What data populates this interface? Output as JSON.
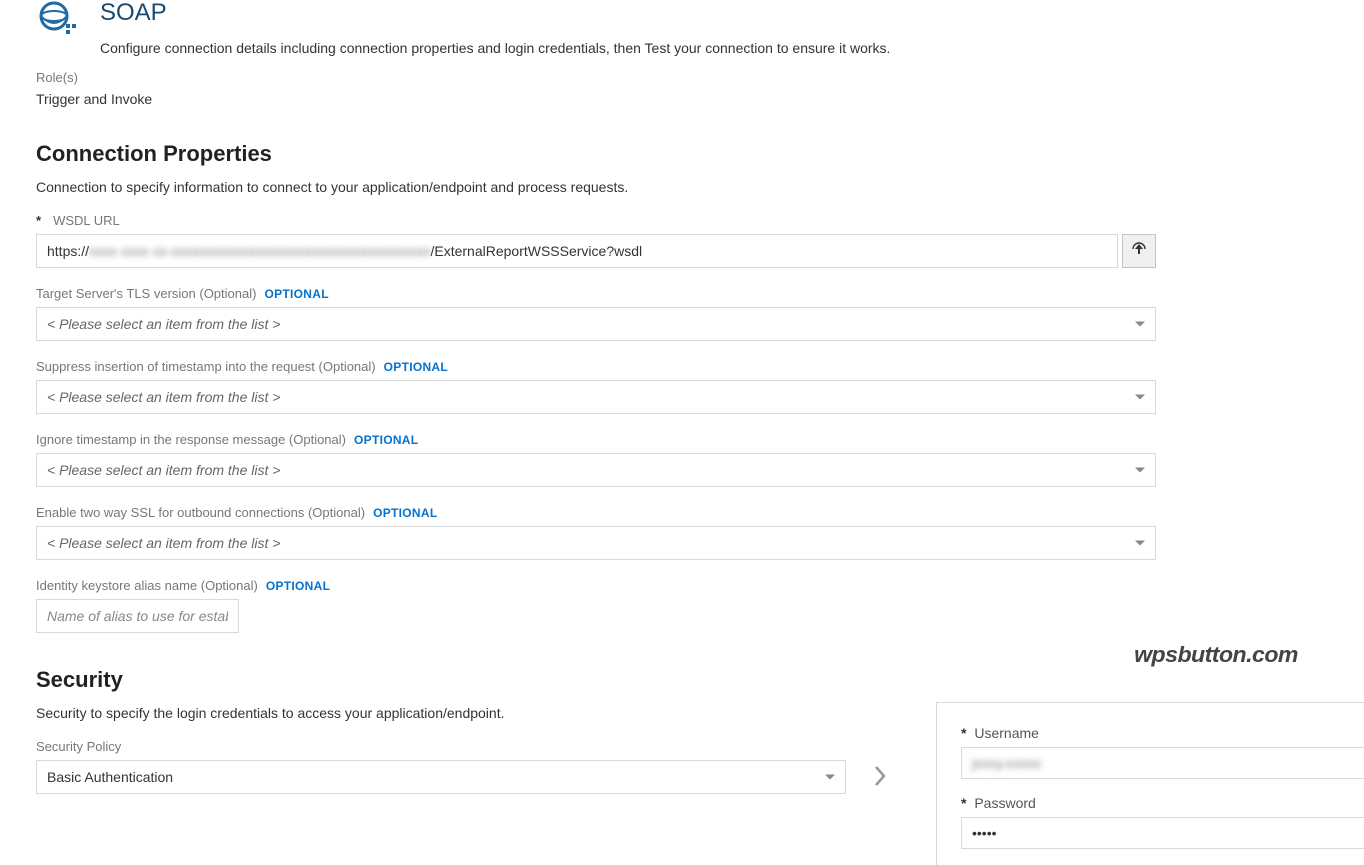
{
  "header": {
    "title": "SOAP",
    "description": "Configure connection details including connection properties and login credentials, then Test your connection to ensure it works.",
    "roles_label": "Role(s)",
    "roles_value": "Trigger and Invoke"
  },
  "connection": {
    "heading": "Connection Properties",
    "description": "Connection to specify information to connect to your application/endpoint and process requests.",
    "wsdl": {
      "label": "WSDL URL",
      "value_prefix": "https://",
      "value_blurred": "xxxx xxxx xx-xxxxxxxxxxxxxxxxxxxxxxxxxxxxxxxxxxxxx",
      "value_suffix": "/ExternalReportWSSService?wsdl"
    },
    "tls": {
      "label": "Target Server's TLS version (Optional)",
      "optional_tag": "OPTIONAL",
      "placeholder": "< Please select an item from the list >"
    },
    "suppress_ts": {
      "label": "Suppress insertion of timestamp into the request (Optional)",
      "optional_tag": "OPTIONAL",
      "placeholder": "< Please select an item from the list >"
    },
    "ignore_ts": {
      "label": "Ignore timestamp in the response message (Optional)",
      "optional_tag": "OPTIONAL",
      "placeholder": "< Please select an item from the list >"
    },
    "twoway_ssl": {
      "label": "Enable two way SSL for outbound connections (Optional)",
      "optional_tag": "OPTIONAL",
      "placeholder": "< Please select an item from the list >"
    },
    "keystore": {
      "label": "Identity keystore alias name (Optional)",
      "optional_tag": "OPTIONAL",
      "placeholder": "Name of alias to use for establishing identity during two way SSL communication"
    }
  },
  "security": {
    "heading": "Security",
    "description": "Security to specify the login credentials to access your application/endpoint.",
    "policy_label": "Security Policy",
    "policy_value": "Basic Authentication",
    "username_label": "Username",
    "username_value": "jxxxy.xxxxx",
    "password_label": "Password",
    "password_value": "•••••"
  },
  "watermark": "wpsbutton.com"
}
